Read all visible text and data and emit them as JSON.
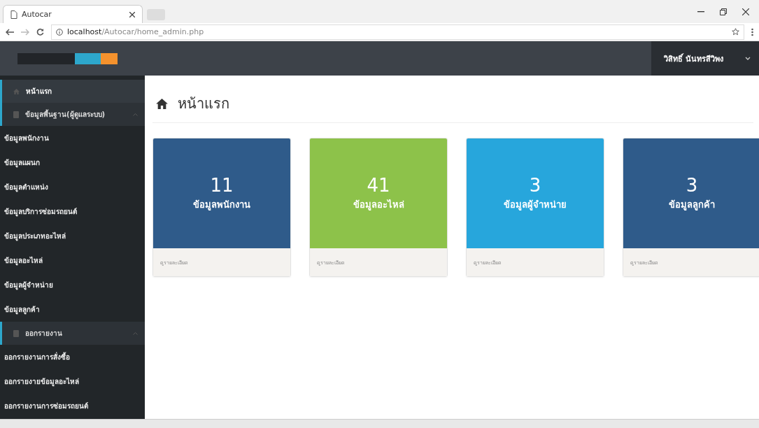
{
  "browser": {
    "tabs": [
      {
        "title": "Autocar",
        "selected": true
      }
    ],
    "url": "**localhost**/Autocar/home_admin.php"
  },
  "header": {
    "user_name": "วิสิทธิ์ นันทรสีวิพง"
  },
  "sidebar": {
    "items": [
      {
        "kind": "link",
        "label": "หน้าแรก",
        "selected": true
      },
      {
        "kind": "group",
        "label": "ข้อมูลพื้นฐาน(ผู้ดูแลระบบ)",
        "expanded": true,
        "selected": false,
        "children": [
          {
            "label": "ข้อมูลพนักงาน",
            "selected": false
          },
          {
            "label": "ข้อมูลแผนก",
            "selected": false
          },
          {
            "label": "ข้อมูลตำแหน่ง",
            "selected": false
          },
          {
            "label": "ข้อมูลบริการซ่อมรถยนต์",
            "selected": false
          },
          {
            "label": "ข้อมูลประเภทอะไหล่",
            "selected": false
          },
          {
            "label": "ข้อมูลอะไหล่",
            "selected": false
          },
          {
            "label": "ข้อมูลผู้จำหน่าย",
            "selected": false
          },
          {
            "label": "ข้อมูลลูกค้า",
            "selected": false
          }
        ]
      },
      {
        "kind": "group",
        "label": "ออกรายงาน",
        "expanded": true,
        "selected": false,
        "children": [
          {
            "label": "ออกรายงานการสั่งซื้อ",
            "selected": false
          },
          {
            "label": "ออกรายงายข้อมูลอะไหล่",
            "selected": false
          },
          {
            "label": "ออกรายงานการซ่อมรถยนต์",
            "selected": false
          }
        ]
      }
    ]
  },
  "page": {
    "title": "หน้าแรก"
  },
  "cards": [
    {
      "count": "11",
      "label": "ข้อมูลพนักงาน",
      "color": "#2f5b8a",
      "footer": "ดูรายละเอียด"
    },
    {
      "count": "41",
      "label": "ข้อมูลอะไหล่",
      "color": "#8dc24a",
      "footer": "ดูรายละเอียด"
    },
    {
      "count": "3",
      "label": "ข้อมูลผู้จำหน่าย",
      "color": "#27a6dc",
      "footer": "ดูรายละเอียด"
    },
    {
      "count": "3",
      "label": "ข้อมูลลูกค้า",
      "color": "#2f5b8a",
      "footer": "ดูรายละเอียด"
    }
  ]
}
